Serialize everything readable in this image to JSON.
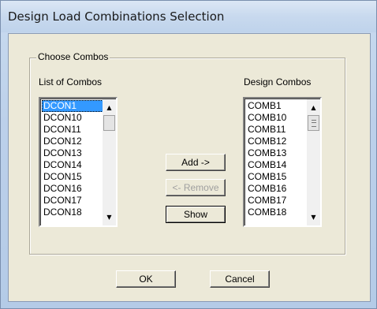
{
  "window": {
    "title": "Design Load Combinations Selection"
  },
  "group": {
    "label": "Choose Combos"
  },
  "left_list": {
    "label": "List of Combos",
    "items": [
      "DCON1",
      "DCON10",
      "DCON11",
      "DCON12",
      "DCON13",
      "DCON14",
      "DCON15",
      "DCON16",
      "DCON17",
      "DCON18"
    ],
    "selected": "DCON1"
  },
  "right_list": {
    "label": "Design Combos",
    "items": [
      "COMB1",
      "COMB10",
      "COMB11",
      "COMB12",
      "COMB13",
      "COMB14",
      "COMB15",
      "COMB16",
      "COMB17",
      "COMB18"
    ]
  },
  "buttons": {
    "add": "Add ->",
    "remove": "<- Remove",
    "show": "Show",
    "ok": "OK",
    "cancel": "Cancel"
  },
  "icons": {
    "scroll_up": "scroll-up-arrow-icon",
    "scroll_down": "scroll-down-arrow-icon"
  }
}
